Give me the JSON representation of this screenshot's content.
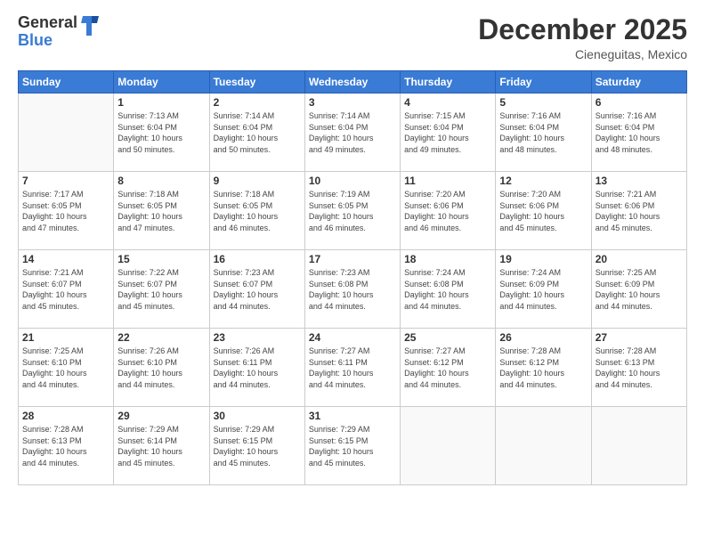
{
  "logo": {
    "general": "General",
    "blue": "Blue"
  },
  "header": {
    "month": "December 2025",
    "location": "Cieneguitas, Mexico"
  },
  "days_of_week": [
    "Sunday",
    "Monday",
    "Tuesday",
    "Wednesday",
    "Thursday",
    "Friday",
    "Saturday"
  ],
  "weeks": [
    [
      {
        "day": "",
        "info": ""
      },
      {
        "day": "1",
        "info": "Sunrise: 7:13 AM\nSunset: 6:04 PM\nDaylight: 10 hours\nand 50 minutes."
      },
      {
        "day": "2",
        "info": "Sunrise: 7:14 AM\nSunset: 6:04 PM\nDaylight: 10 hours\nand 50 minutes."
      },
      {
        "day": "3",
        "info": "Sunrise: 7:14 AM\nSunset: 6:04 PM\nDaylight: 10 hours\nand 49 minutes."
      },
      {
        "day": "4",
        "info": "Sunrise: 7:15 AM\nSunset: 6:04 PM\nDaylight: 10 hours\nand 49 minutes."
      },
      {
        "day": "5",
        "info": "Sunrise: 7:16 AM\nSunset: 6:04 PM\nDaylight: 10 hours\nand 48 minutes."
      },
      {
        "day": "6",
        "info": "Sunrise: 7:16 AM\nSunset: 6:04 PM\nDaylight: 10 hours\nand 48 minutes."
      }
    ],
    [
      {
        "day": "7",
        "info": "Sunrise: 7:17 AM\nSunset: 6:05 PM\nDaylight: 10 hours\nand 47 minutes."
      },
      {
        "day": "8",
        "info": "Sunrise: 7:18 AM\nSunset: 6:05 PM\nDaylight: 10 hours\nand 47 minutes."
      },
      {
        "day": "9",
        "info": "Sunrise: 7:18 AM\nSunset: 6:05 PM\nDaylight: 10 hours\nand 46 minutes."
      },
      {
        "day": "10",
        "info": "Sunrise: 7:19 AM\nSunset: 6:05 PM\nDaylight: 10 hours\nand 46 minutes."
      },
      {
        "day": "11",
        "info": "Sunrise: 7:20 AM\nSunset: 6:06 PM\nDaylight: 10 hours\nand 46 minutes."
      },
      {
        "day": "12",
        "info": "Sunrise: 7:20 AM\nSunset: 6:06 PM\nDaylight: 10 hours\nand 45 minutes."
      },
      {
        "day": "13",
        "info": "Sunrise: 7:21 AM\nSunset: 6:06 PM\nDaylight: 10 hours\nand 45 minutes."
      }
    ],
    [
      {
        "day": "14",
        "info": "Sunrise: 7:21 AM\nSunset: 6:07 PM\nDaylight: 10 hours\nand 45 minutes."
      },
      {
        "day": "15",
        "info": "Sunrise: 7:22 AM\nSunset: 6:07 PM\nDaylight: 10 hours\nand 45 minutes."
      },
      {
        "day": "16",
        "info": "Sunrise: 7:23 AM\nSunset: 6:07 PM\nDaylight: 10 hours\nand 44 minutes."
      },
      {
        "day": "17",
        "info": "Sunrise: 7:23 AM\nSunset: 6:08 PM\nDaylight: 10 hours\nand 44 minutes."
      },
      {
        "day": "18",
        "info": "Sunrise: 7:24 AM\nSunset: 6:08 PM\nDaylight: 10 hours\nand 44 minutes."
      },
      {
        "day": "19",
        "info": "Sunrise: 7:24 AM\nSunset: 6:09 PM\nDaylight: 10 hours\nand 44 minutes."
      },
      {
        "day": "20",
        "info": "Sunrise: 7:25 AM\nSunset: 6:09 PM\nDaylight: 10 hours\nand 44 minutes."
      }
    ],
    [
      {
        "day": "21",
        "info": "Sunrise: 7:25 AM\nSunset: 6:10 PM\nDaylight: 10 hours\nand 44 minutes."
      },
      {
        "day": "22",
        "info": "Sunrise: 7:26 AM\nSunset: 6:10 PM\nDaylight: 10 hours\nand 44 minutes."
      },
      {
        "day": "23",
        "info": "Sunrise: 7:26 AM\nSunset: 6:11 PM\nDaylight: 10 hours\nand 44 minutes."
      },
      {
        "day": "24",
        "info": "Sunrise: 7:27 AM\nSunset: 6:11 PM\nDaylight: 10 hours\nand 44 minutes."
      },
      {
        "day": "25",
        "info": "Sunrise: 7:27 AM\nSunset: 6:12 PM\nDaylight: 10 hours\nand 44 minutes."
      },
      {
        "day": "26",
        "info": "Sunrise: 7:28 AM\nSunset: 6:12 PM\nDaylight: 10 hours\nand 44 minutes."
      },
      {
        "day": "27",
        "info": "Sunrise: 7:28 AM\nSunset: 6:13 PM\nDaylight: 10 hours\nand 44 minutes."
      }
    ],
    [
      {
        "day": "28",
        "info": "Sunrise: 7:28 AM\nSunset: 6:13 PM\nDaylight: 10 hours\nand 44 minutes."
      },
      {
        "day": "29",
        "info": "Sunrise: 7:29 AM\nSunset: 6:14 PM\nDaylight: 10 hours\nand 45 minutes."
      },
      {
        "day": "30",
        "info": "Sunrise: 7:29 AM\nSunset: 6:15 PM\nDaylight: 10 hours\nand 45 minutes."
      },
      {
        "day": "31",
        "info": "Sunrise: 7:29 AM\nSunset: 6:15 PM\nDaylight: 10 hours\nand 45 minutes."
      },
      {
        "day": "",
        "info": ""
      },
      {
        "day": "",
        "info": ""
      },
      {
        "day": "",
        "info": ""
      }
    ]
  ]
}
